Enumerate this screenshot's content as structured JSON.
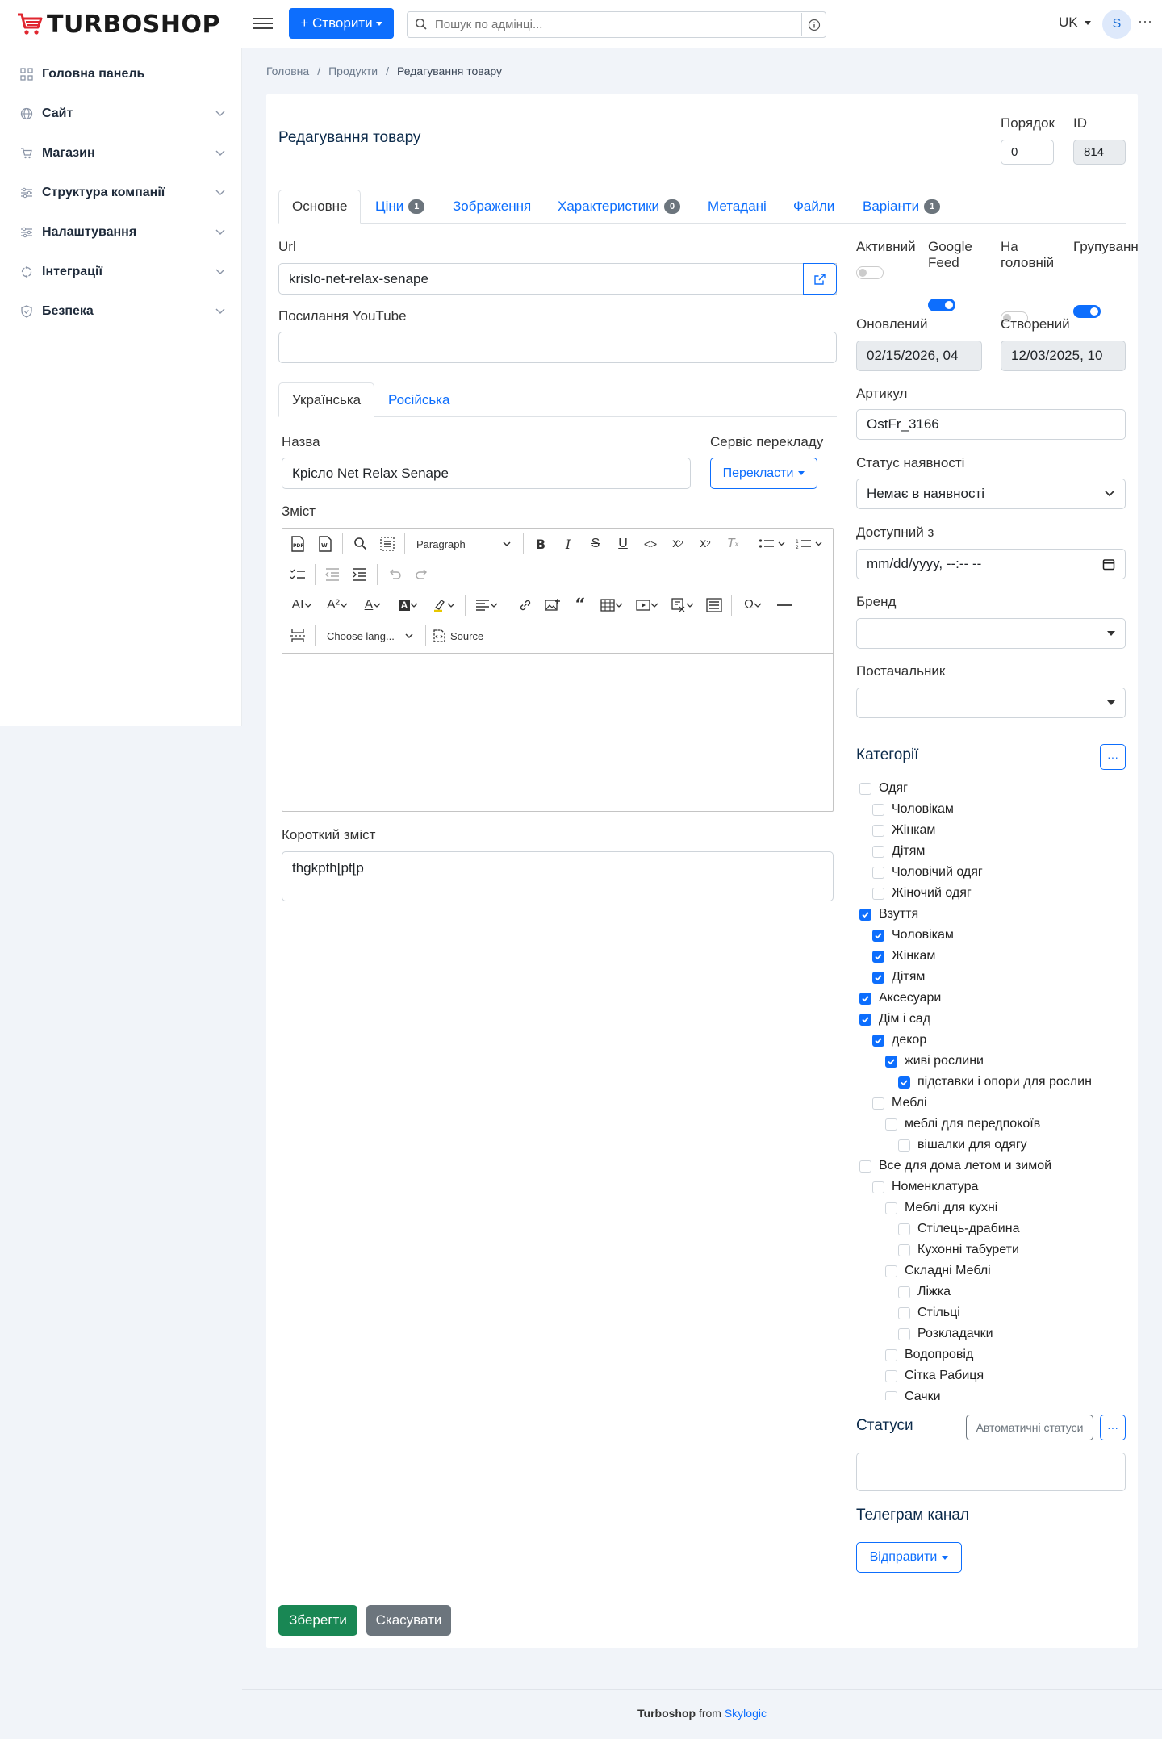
{
  "header": {
    "logo_text": "TURBOSHOP",
    "create_label": "+ Створити",
    "search_placeholder": "Пошук по адмінці...",
    "lang": "UK",
    "avatar_letter": "S",
    "more": "···"
  },
  "sidebar": {
    "items": [
      {
        "label": "Головна панель",
        "icon": "grid-icon"
      },
      {
        "label": "Сайт",
        "icon": "globe-icon"
      },
      {
        "label": "Магазин",
        "icon": "cart-icon"
      },
      {
        "label": "Структура компанії",
        "icon": "sliders-icon"
      },
      {
        "label": "Налаштування",
        "icon": "sliders-icon"
      },
      {
        "label": "Інтеграції",
        "icon": "integration-icon"
      },
      {
        "label": "Безпека",
        "icon": "shield-icon"
      }
    ]
  },
  "breadcrumb": {
    "home": "Головна",
    "products": "Продукти",
    "current": "Редагування товару",
    "sep": "/"
  },
  "page": {
    "title": "Редагування товару",
    "order_label": "Порядок",
    "order_value": "0",
    "id_label": "ID",
    "id_value": "814"
  },
  "tabs": [
    {
      "label": "Основне",
      "badge": ""
    },
    {
      "label": "Ціни",
      "badge": "1"
    },
    {
      "label": "Зображення",
      "badge": ""
    },
    {
      "label": "Характеристики",
      "badge": "0"
    },
    {
      "label": "Метадані",
      "badge": ""
    },
    {
      "label": "Файли",
      "badge": ""
    },
    {
      "label": "Варіанти",
      "badge": "1"
    }
  ],
  "form": {
    "url_label": "Url",
    "url_value": "krislo-net-relax-senape",
    "youtube_label": "Посилання YouTube",
    "youtube_value": "",
    "lang_tabs": [
      "Українська",
      "Російська"
    ],
    "name_label": "Назва",
    "name_value": "Крісло Net Relax Senape",
    "translate_label": "Сервіс перекладу",
    "translate_btn": "Перекласти",
    "content_label": "Зміст",
    "short_label": "Короткий зміст",
    "short_value": "thgkpth[pt[p",
    "editor": {
      "paragraph": "Paragraph",
      "choose_lang": "Choose lang...",
      "source": "Source"
    }
  },
  "right": {
    "active_label": "Активний",
    "gfeed_label1": "Google",
    "gfeed_label2": "Feed",
    "main_label1": "На",
    "main_label2": "головній",
    "group_label": "Групуванн",
    "toggles": {
      "active": false,
      "gfeed": true,
      "main": false,
      "group": true
    },
    "updated_label": "Оновлений",
    "updated_value": "02/15/2026, 04",
    "created_label": "Створений",
    "created_value": "12/03/2025, 10",
    "sku_label": "Артикул",
    "sku_value": "OstFr_3166",
    "avail_label": "Статус наявності",
    "avail_value": "Немає в наявності",
    "available_from_label": "Доступний з",
    "available_from_value": "mm/dd/yyyy, --:-- --",
    "brand_label": "Бренд",
    "supplier_label": "Постачальник",
    "categories_title": "Категорії",
    "categories": [
      {
        "label": "Одяг",
        "level": 0,
        "checked": false
      },
      {
        "label": "Чоловікам",
        "level": 1,
        "checked": false
      },
      {
        "label": "Жінкам",
        "level": 1,
        "checked": false
      },
      {
        "label": "Дітям",
        "level": 1,
        "checked": false
      },
      {
        "label": "Чоловічий одяг",
        "level": 1,
        "checked": false
      },
      {
        "label": "Жіночий одяг",
        "level": 1,
        "checked": false
      },
      {
        "label": "Взуття",
        "level": 0,
        "checked": true
      },
      {
        "label": "Чоловікам",
        "level": 1,
        "checked": true
      },
      {
        "label": "Жінкам",
        "level": 1,
        "checked": true
      },
      {
        "label": "Дітям",
        "level": 1,
        "checked": true
      },
      {
        "label": "Аксесуари",
        "level": 0,
        "checked": true
      },
      {
        "label": "Дім і сад",
        "level": 0,
        "checked": true
      },
      {
        "label": "декор",
        "level": 1,
        "checked": true
      },
      {
        "label": "живі рослини",
        "level": 2,
        "checked": true
      },
      {
        "label": "підставки і опори для рослин",
        "level": 3,
        "checked": true
      },
      {
        "label": "Меблі",
        "level": 1,
        "checked": false
      },
      {
        "label": "меблі для передпокоїв",
        "level": 2,
        "checked": false
      },
      {
        "label": "вішалки для одягу",
        "level": 3,
        "checked": false
      },
      {
        "label": "Все для дома летом и зимой",
        "level": 0,
        "checked": false
      },
      {
        "label": "Номенклатура",
        "level": 1,
        "checked": false
      },
      {
        "label": "Меблі для кухні",
        "level": 2,
        "checked": false
      },
      {
        "label": "Стілець-драбина",
        "level": 3,
        "checked": false
      },
      {
        "label": "Кухонні табурети",
        "level": 3,
        "checked": false
      },
      {
        "label": "Складні Меблі",
        "level": 2,
        "checked": false
      },
      {
        "label": "Ліжка",
        "level": 3,
        "checked": false
      },
      {
        "label": "Стільці",
        "level": 3,
        "checked": false
      },
      {
        "label": "Розкладачки",
        "level": 3,
        "checked": false
      },
      {
        "label": "Водопровід",
        "level": 2,
        "checked": false
      },
      {
        "label": "Сітка Рабиця",
        "level": 2,
        "checked": false
      },
      {
        "label": "Сачки",
        "level": 2,
        "checked": false
      }
    ],
    "statuses_title": "Статуси",
    "auto_statuses_btn": "Автоматичні статуси",
    "telegram_title": "Телеграм канал",
    "send_btn": "Відправити"
  },
  "actions": {
    "save": "Зберегти",
    "cancel": "Скасувати"
  },
  "footer": {
    "brand": "Turboshop",
    "from": " from ",
    "company": "Skylogic"
  },
  "colors": {
    "primary": "#0d6efd",
    "success": "#198754",
    "secondary": "#6c757d"
  }
}
